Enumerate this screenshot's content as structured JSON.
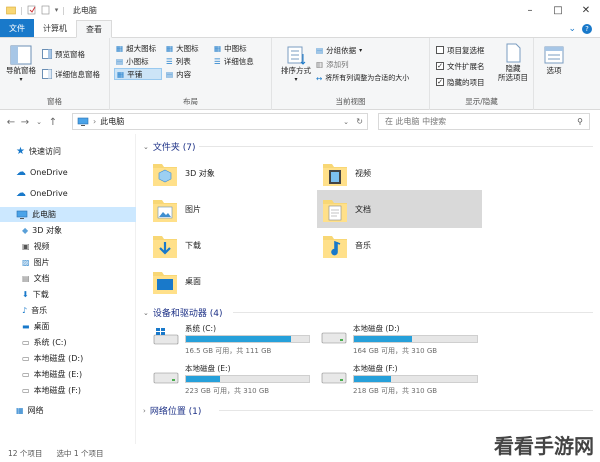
{
  "window": {
    "title": "此电脑"
  },
  "colors": {
    "accent": "#1979ca",
    "selection": "#cce8ff",
    "drive_fill": "#26a0da"
  },
  "tabs": [
    {
      "label": "文件"
    },
    {
      "label": "计算机"
    },
    {
      "label": "查看"
    }
  ],
  "ribbon": {
    "pane": {
      "nav_pane": "导航窗格",
      "preview_pane": "预览窗格",
      "details_pane": "详细信息窗格",
      "group": "窗格"
    },
    "layout": {
      "items": [
        "超大图标",
        "大图标",
        "中图标",
        "小图标",
        "列表",
        "详细信息",
        "平铺",
        "内容"
      ],
      "selected": "平铺",
      "group": "布局"
    },
    "current_view": {
      "sort_by": "排序方式",
      "group_by": "分组依据",
      "add_columns": "添加列",
      "size_all": "将所有列调整为合适的大小",
      "group": "当前视图"
    },
    "show_hide": {
      "item_checkboxes": {
        "label": "项目复选框",
        "checked": false
      },
      "file_extensions": {
        "label": "文件扩展名",
        "checked": true
      },
      "hidden_items": {
        "label": "隐藏的项目",
        "checked": true
      },
      "hide_selected": "隐藏\n所选项目",
      "hide": "隐藏",
      "selected_items": "所选项目",
      "group": "显示/隐藏"
    },
    "options": "选项"
  },
  "address": {
    "location": "此电脑",
    "search_placeholder": "在 此电脑 中搜索"
  },
  "nav": [
    {
      "label": "快速访问",
      "icon": "star-icon"
    },
    {
      "label": "OneDrive",
      "icon": "cloud-icon"
    },
    {
      "label": "OneDrive",
      "icon": "cloud-icon"
    },
    {
      "label": "此电脑",
      "icon": "computer-icon",
      "selected": true
    },
    {
      "label": "3D 对象",
      "icon": "cube-icon"
    },
    {
      "label": "视频",
      "icon": "video-icon"
    },
    {
      "label": "图片",
      "icon": "picture-icon"
    },
    {
      "label": "文档",
      "icon": "document-icon"
    },
    {
      "label": "下载",
      "icon": "download-icon"
    },
    {
      "label": "音乐",
      "icon": "music-icon"
    },
    {
      "label": "桌面",
      "icon": "desktop-icon"
    },
    {
      "label": "系统 (C:)",
      "icon": "drive-icon"
    },
    {
      "label": "本地磁盘 (D:)",
      "icon": "drive-icon"
    },
    {
      "label": "本地磁盘 (E:)",
      "icon": "drive-icon"
    },
    {
      "label": "本地磁盘 (F:)",
      "icon": "drive-icon"
    },
    {
      "label": "网络",
      "icon": "network-icon"
    }
  ],
  "sections": {
    "folders": "文件夹 (7)",
    "devices": "设备和驱动器 (4)",
    "network": "网络位置 (1)"
  },
  "folders": [
    {
      "label": "3D 对象",
      "icon": "cube-folder-icon"
    },
    {
      "label": "视频",
      "icon": "video-folder-icon"
    },
    {
      "label": "图片",
      "icon": "picture-folder-icon"
    },
    {
      "label": "文档",
      "icon": "document-folder-icon",
      "selected": true
    },
    {
      "label": "下载",
      "icon": "download-folder-icon"
    },
    {
      "label": "音乐",
      "icon": "music-folder-icon"
    },
    {
      "label": "桌面",
      "icon": "desktop-folder-icon"
    }
  ],
  "drives": [
    {
      "name": "系统 (C:)",
      "size_text": "16.5 GB 可用，共 111 GB",
      "used_fraction": 0.85,
      "icon": "windows-drive-icon"
    },
    {
      "name": "本地磁盘 (D:)",
      "size_text": "164 GB 可用，共 310 GB",
      "used_fraction": 0.47,
      "icon": "drive-icon"
    },
    {
      "name": "本地磁盘 (E:)",
      "size_text": "223 GB 可用，共 310 GB",
      "used_fraction": 0.28,
      "icon": "drive-icon"
    },
    {
      "name": "本地磁盘 (F:)",
      "size_text": "218 GB 可用，共 310 GB",
      "used_fraction": 0.3,
      "icon": "drive-icon"
    }
  ],
  "status": {
    "items": "12 个项目",
    "selected": "选中 1 个项目"
  },
  "watermark": "看看手游网"
}
